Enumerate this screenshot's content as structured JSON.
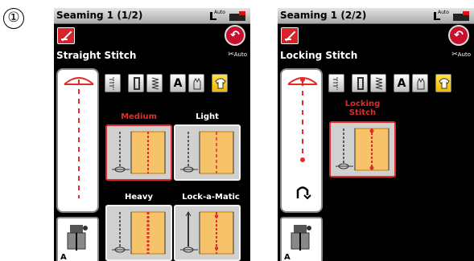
{
  "step_marker": "①",
  "screens": [
    {
      "title": "Seaming 1 (1/2)",
      "auto_lift_text": "Auto",
      "stitch_name": "Straight Stitch",
      "auto_thread_cut": "Auto",
      "foot_letter": "A",
      "category_icons": [
        "buttonhole-icon",
        "bartack-icon",
        "overcast-icon",
        "letter-a-icon",
        "applique-hand-icon",
        "garment-icon"
      ],
      "category_letter": "A",
      "active_category": "garment-icon",
      "patterns": [
        {
          "label": "Medium",
          "selected": true
        },
        {
          "label": "Light",
          "selected": false
        },
        {
          "label": "Heavy",
          "selected": false
        },
        {
          "label": "Lock-a-Matic",
          "selected": false
        }
      ]
    },
    {
      "title": "Seaming 1 (2/2)",
      "auto_lift_text": "Auto",
      "stitch_name": "Locking Stitch",
      "auto_thread_cut": "Auto",
      "foot_letter": "A",
      "category_icons": [
        "buttonhole-icon",
        "bartack-icon",
        "overcast-icon",
        "letter-a-icon",
        "applique-hand-icon",
        "garment-icon"
      ],
      "category_letter": "A",
      "active_category": "garment-icon",
      "patterns": [
        {
          "label": "Locking\nStitch",
          "selected": true
        }
      ]
    }
  ],
  "colors": {
    "accent_red": "#e32b2b",
    "active_yellow": "#f5b800",
    "screen_bg": "#000000"
  }
}
